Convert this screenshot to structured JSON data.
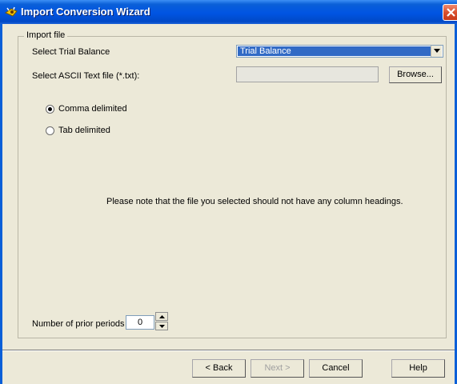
{
  "window": {
    "title": "Import Conversion Wizard"
  },
  "group": {
    "legend": "Import file"
  },
  "trial_balance": {
    "label": "Select Trial Balance",
    "selected": "Trial Balance"
  },
  "ascii_file": {
    "label": "Select ASCII Text file (*.txt):",
    "value": "",
    "browse_label": "Browse..."
  },
  "delimiter": {
    "comma_label": "Comma delimited",
    "tab_label": "Tab delimited",
    "selected": "comma"
  },
  "note": "Please note that the file you selected should not have any column headings.",
  "prior_periods": {
    "label": "Number of prior periods",
    "value": "0"
  },
  "buttons": {
    "back": "< Back",
    "next": "Next >",
    "cancel": "Cancel",
    "help": "Help"
  },
  "colors": {
    "title_bar": "#0054e3",
    "dialog_bg": "#ece9d8",
    "selection": "#316ac5"
  },
  "icons": {
    "app": "wizard-icon",
    "close": "close-icon",
    "dropdown": "chevron-down-icon",
    "spin_up": "arrow-up-icon",
    "spin_down": "arrow-down-icon"
  }
}
